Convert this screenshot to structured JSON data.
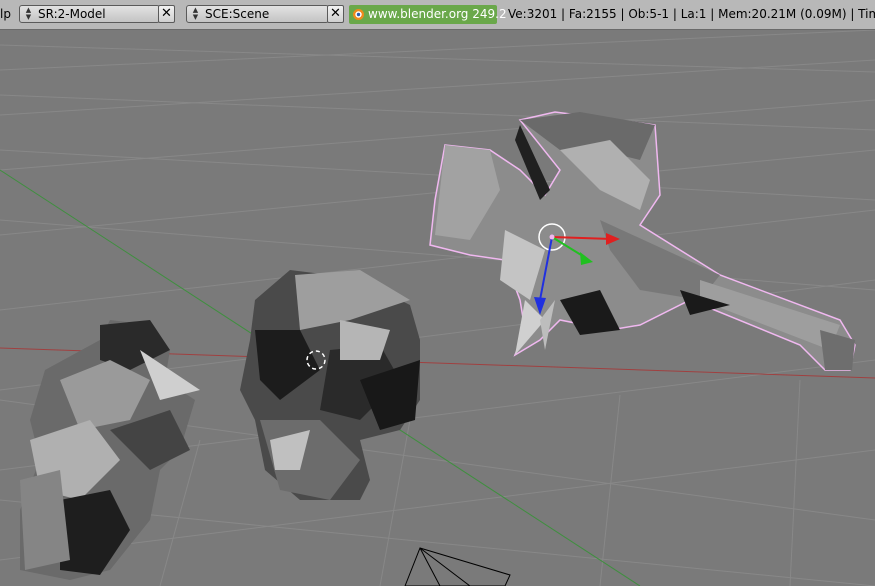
{
  "header": {
    "menu_stub": "lp",
    "screen_selector": {
      "value": "SR:2-Model"
    },
    "scene_selector": {
      "value": "SCE:Scene"
    },
    "website": {
      "text": "www.blender.org 249.2"
    },
    "stats": "Ve:3201 | Fa:2155 | Ob:5-1 | La:1  | Mem:20.21M (0.09M)  | Time"
  },
  "icons": {
    "close": "close-icon",
    "spinner": "up-down-arrows-icon",
    "blender_logo": "blender-logo-icon",
    "cursor3d": "3d-cursor-icon",
    "transform_manipulator": "transform-manipulator-icon"
  },
  "colors": {
    "header_bg": "#b8b8b8",
    "viewport_bg": "#7a7a7a",
    "website_bg": "#6aa84a",
    "selection_outline": "#f0b8f0",
    "x_axis": "#e02020",
    "y_axis": "#20c020",
    "z_axis": "#2030e0"
  }
}
